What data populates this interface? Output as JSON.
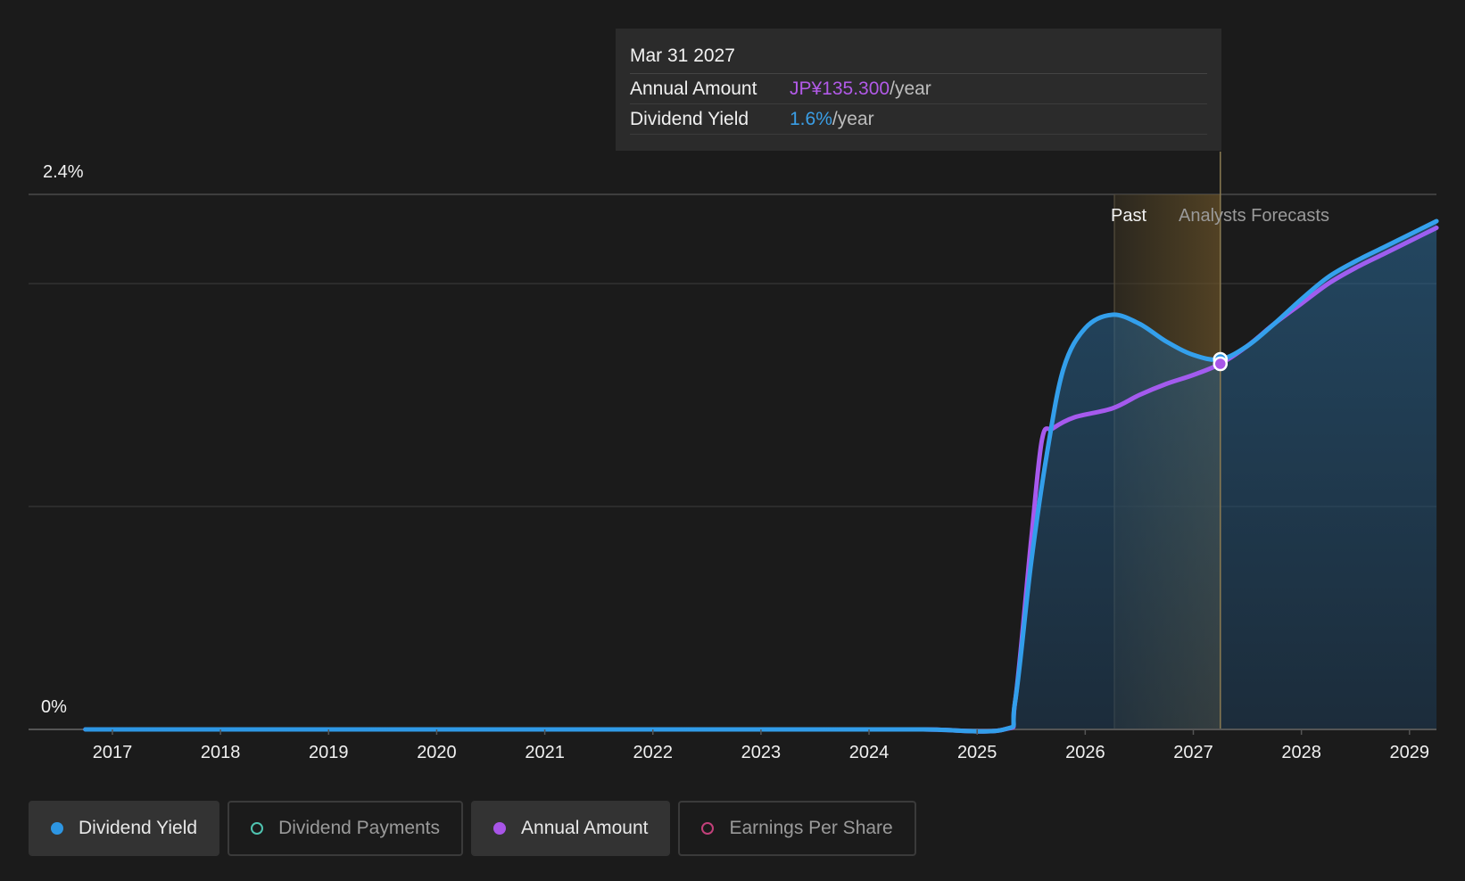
{
  "chart_data": {
    "type": "line",
    "y_ticks": [
      "2.4%",
      "0%"
    ],
    "ylim": [
      0,
      2.4
    ],
    "xlim": [
      2016.5,
      2029.25
    ],
    "x_ticks": [
      "2017",
      "2018",
      "2019",
      "2020",
      "2021",
      "2022",
      "2023",
      "2024",
      "2025",
      "2026",
      "2027",
      "2028",
      "2029"
    ],
    "grid": true,
    "regions": {
      "past_label": "Past",
      "forecast_label": "Analysts Forecasts"
    },
    "series": [
      {
        "name": "Dividend Yield",
        "unit": "%",
        "color": "#2d96e3",
        "points": [
          [
            2016.75,
            0
          ],
          [
            2017.5,
            0
          ],
          [
            2018.5,
            0
          ],
          [
            2019.5,
            0
          ],
          [
            2020.5,
            0
          ],
          [
            2021.5,
            0
          ],
          [
            2022.5,
            0
          ],
          [
            2023.5,
            0
          ],
          [
            2024.5,
            0
          ],
          [
            2025.25,
            0
          ],
          [
            2025.35,
            0.12
          ],
          [
            2025.5,
            0.75
          ],
          [
            2025.65,
            1.25
          ],
          [
            2025.8,
            1.62
          ],
          [
            2026.0,
            1.8
          ],
          [
            2026.25,
            1.86
          ],
          [
            2026.5,
            1.82
          ],
          [
            2026.75,
            1.74
          ],
          [
            2027.0,
            1.68
          ],
          [
            2027.25,
            1.66
          ],
          [
            2027.5,
            1.72
          ],
          [
            2027.75,
            1.82
          ],
          [
            2028.0,
            1.93
          ],
          [
            2028.25,
            2.03
          ],
          [
            2028.5,
            2.1
          ],
          [
            2028.75,
            2.16
          ],
          [
            2029.0,
            2.22
          ],
          [
            2029.25,
            2.28
          ]
        ]
      },
      {
        "name": "Annual Amount",
        "unit": "JP¥",
        "color": "#a855e8",
        "points": [
          [
            2016.75,
            0
          ],
          [
            2017.5,
            0
          ],
          [
            2018.5,
            0
          ],
          [
            2019.5,
            0
          ],
          [
            2020.5,
            0
          ],
          [
            2021.5,
            0
          ],
          [
            2022.5,
            0
          ],
          [
            2023.5,
            0
          ],
          [
            2024.5,
            0
          ],
          [
            2025.25,
            0
          ],
          [
            2025.35,
            0.12
          ],
          [
            2025.5,
            0.85
          ],
          [
            2025.6,
            1.3
          ],
          [
            2025.7,
            1.35
          ],
          [
            2025.9,
            1.4
          ],
          [
            2026.25,
            1.44
          ],
          [
            2026.5,
            1.5
          ],
          [
            2026.75,
            1.55
          ],
          [
            2027.0,
            1.59
          ],
          [
            2027.25,
            1.64
          ],
          [
            2027.5,
            1.72
          ],
          [
            2027.75,
            1.82
          ],
          [
            2028.0,
            1.91
          ],
          [
            2028.25,
            2.0
          ],
          [
            2028.5,
            2.07
          ],
          [
            2028.75,
            2.13
          ],
          [
            2029.0,
            2.19
          ],
          [
            2029.25,
            2.25
          ]
        ]
      }
    ],
    "highlight": {
      "date_label": "Mar 31 2027",
      "x": 2027.25,
      "rows": [
        {
          "label": "Annual Amount",
          "value": "JP¥135.300",
          "suffix": "/year"
        },
        {
          "label": "Dividend Yield",
          "value": "1.6%",
          "suffix": "/year"
        }
      ]
    }
  },
  "legend": [
    {
      "label": "Dividend Yield",
      "color": "#2d96e3",
      "active": true,
      "filled": true
    },
    {
      "label": "Dividend Payments",
      "color": "#4fc3b0",
      "active": false,
      "filled": false
    },
    {
      "label": "Annual Amount",
      "color": "#a855e8",
      "active": true,
      "filled": true
    },
    {
      "label": "Earnings Per Share",
      "color": "#c2407a",
      "active": false,
      "filled": false
    }
  ]
}
